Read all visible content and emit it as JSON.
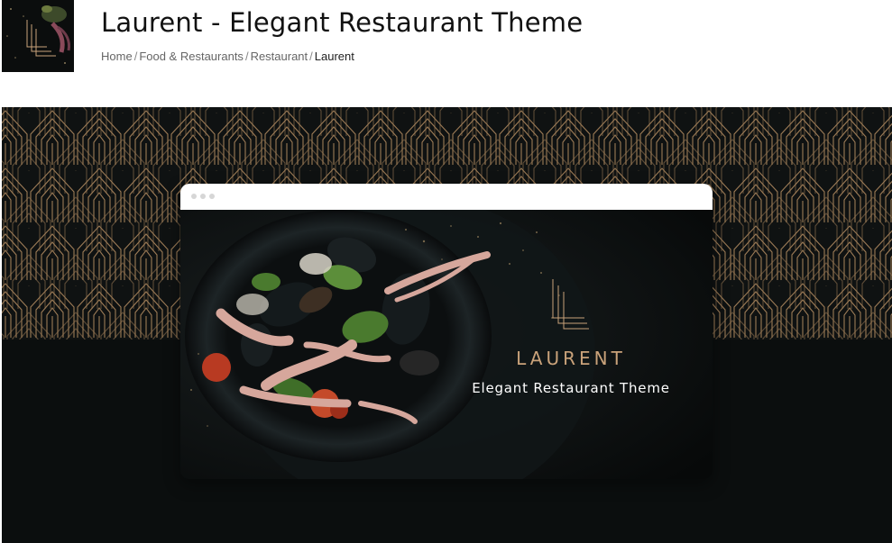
{
  "header": {
    "title": "Laurent - Elegant Restaurant Theme",
    "breadcrumb": [
      {
        "label": "Home"
      },
      {
        "label": "Food & Restaurants"
      },
      {
        "label": "Restaurant"
      },
      {
        "label": "Laurent"
      }
    ]
  },
  "preview": {
    "brand_name": "LAURENT",
    "tagline": "Elegant Restaurant Theme"
  },
  "colors": {
    "background_dark": "#0b0e0e",
    "gold_accent": "#c9a27a",
    "pattern_line": "#9b7a55"
  },
  "icons": {
    "thumbnail": "product-thumbnail-image",
    "logo": "laurent-monogram-logo"
  }
}
